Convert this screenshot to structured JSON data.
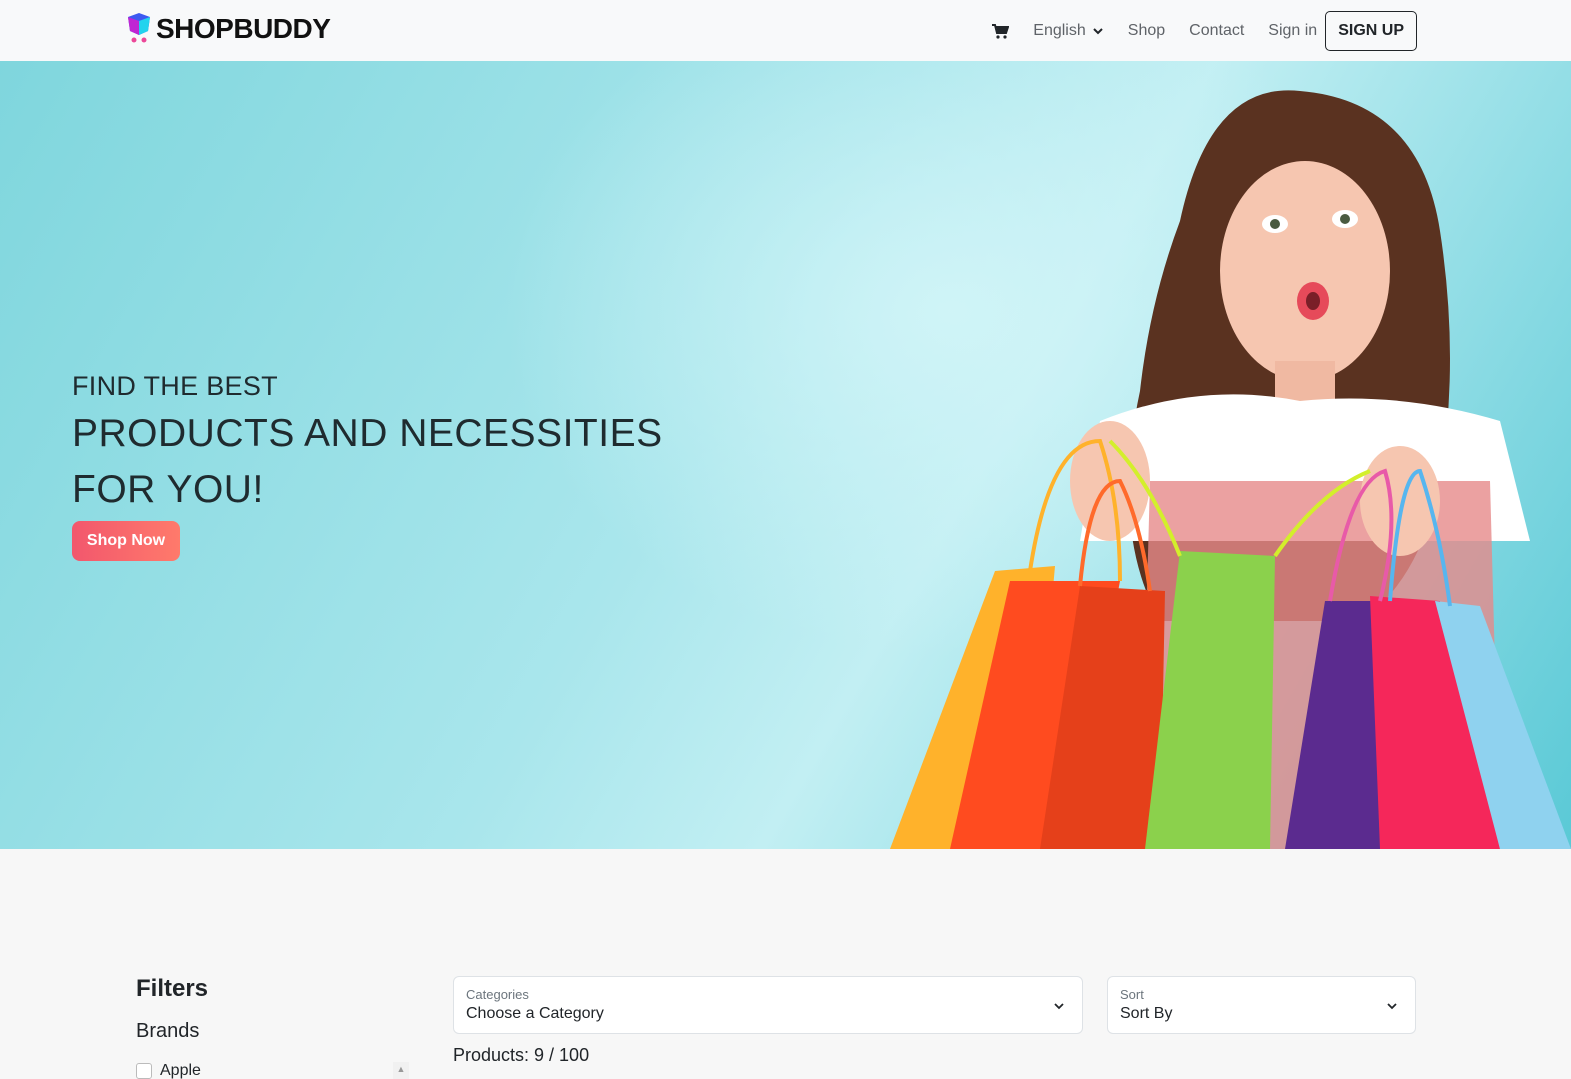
{
  "navbar": {
    "brand": "SHOPBUDDY",
    "language": "English",
    "links": {
      "shop": "Shop",
      "contact": "Contact",
      "signin": "Sign in"
    },
    "signup": "SIGN UP"
  },
  "hero": {
    "line1": "FIND THE BEST",
    "line2": "PRODUCTS AND NECESSITIES",
    "line3": "FOR YOU!",
    "cta": "Shop Now"
  },
  "filters": {
    "title": "Filters",
    "brands_title": "Brands",
    "brands": [
      "Apple"
    ]
  },
  "controls": {
    "categories_label": "Categories",
    "categories_value": "Choose a Category",
    "sort_label": "Sort",
    "sort_value": "Sort By"
  },
  "products": {
    "label": "Products: 9 / 100"
  },
  "colors": {
    "accent": "#f2576d",
    "hero_bg": "#7fd6dd"
  }
}
